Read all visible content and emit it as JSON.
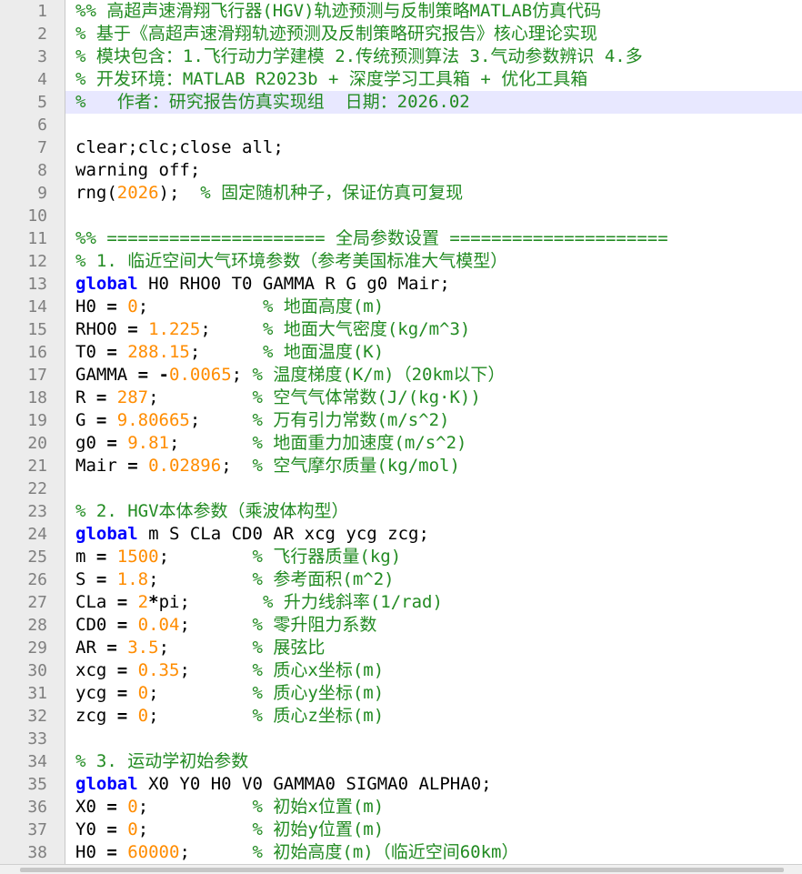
{
  "editor": {
    "current_line": 5,
    "colors": {
      "comment": "#228b22",
      "keyword": "#0000ff",
      "number": "#ff8c00",
      "code": "#000000",
      "current_line_bg": "#e8e8ff"
    },
    "lines": [
      {
        "n": "1",
        "tokens": [
          {
            "t": "%% 高超声速滑翔飞行器(HGV)轨迹预测与反制策略MATLAB仿真代码",
            "c": "comment"
          }
        ]
      },
      {
        "n": "2",
        "tokens": [
          {
            "t": "% 基于《高超声速滑翔轨迹预测及反制策略研究报告》核心理论实现",
            "c": "comment"
          }
        ]
      },
      {
        "n": "3",
        "tokens": [
          {
            "t": "% 模块包含：1.飞行动力学建模 2.传统预测算法 3.气动参数辨识 4.多",
            "c": "comment"
          }
        ]
      },
      {
        "n": "4",
        "tokens": [
          {
            "t": "% 开发环境：MATLAB R2023b + 深度学习工具箱 + 优化工具箱",
            "c": "comment"
          }
        ]
      },
      {
        "n": "5",
        "tokens": [
          {
            "t": "%   作者：研究报告仿真实现组  日期：2026.02",
            "c": "comment"
          }
        ]
      },
      {
        "n": "6",
        "tokens": []
      },
      {
        "n": "7",
        "tokens": [
          {
            "t": "clear;clc;close all;",
            "c": "code"
          }
        ]
      },
      {
        "n": "8",
        "tokens": [
          {
            "t": "warning off;",
            "c": "code"
          }
        ]
      },
      {
        "n": "9",
        "tokens": [
          {
            "t": "rng(",
            "c": "code"
          },
          {
            "t": "2026",
            "c": "number"
          },
          {
            "t": ");  ",
            "c": "code"
          },
          {
            "t": "% 固定随机种子，保证仿真可复现",
            "c": "comment"
          }
        ]
      },
      {
        "n": "10",
        "tokens": []
      },
      {
        "n": "11",
        "tokens": [
          {
            "t": "%% ===================== 全局参数设置 =====================",
            "c": "comment"
          }
        ]
      },
      {
        "n": "12",
        "tokens": [
          {
            "t": "% 1. 临近空间大气环境参数（参考美国标准大气模型）",
            "c": "comment"
          }
        ]
      },
      {
        "n": "13",
        "tokens": [
          {
            "t": "global",
            "c": "keyword"
          },
          {
            "t": " H0 RHO0 T0 GAMMA R G g0 Mair;",
            "c": "code"
          }
        ]
      },
      {
        "n": "14",
        "tokens": [
          {
            "t": "H0 ",
            "c": "code"
          },
          {
            "t": "=",
            "c": "op"
          },
          {
            "t": " ",
            "c": "code"
          },
          {
            "t": "0",
            "c": "number"
          },
          {
            "t": ";           ",
            "c": "code"
          },
          {
            "t": "% 地面高度(m)",
            "c": "comment"
          }
        ]
      },
      {
        "n": "15",
        "tokens": [
          {
            "t": "RHO0 ",
            "c": "code"
          },
          {
            "t": "=",
            "c": "op"
          },
          {
            "t": " ",
            "c": "code"
          },
          {
            "t": "1.225",
            "c": "number"
          },
          {
            "t": ";     ",
            "c": "code"
          },
          {
            "t": "% 地面大气密度(kg/m^3)",
            "c": "comment"
          }
        ]
      },
      {
        "n": "16",
        "tokens": [
          {
            "t": "T0 ",
            "c": "code"
          },
          {
            "t": "=",
            "c": "op"
          },
          {
            "t": " ",
            "c": "code"
          },
          {
            "t": "288.15",
            "c": "number"
          },
          {
            "t": ";      ",
            "c": "code"
          },
          {
            "t": "% 地面温度(K)",
            "c": "comment"
          }
        ]
      },
      {
        "n": "17",
        "tokens": [
          {
            "t": "GAMMA ",
            "c": "code"
          },
          {
            "t": "=",
            "c": "op"
          },
          {
            "t": " ",
            "c": "code"
          },
          {
            "t": "-",
            "c": "op"
          },
          {
            "t": "0.0065",
            "c": "number"
          },
          {
            "t": "; ",
            "c": "code"
          },
          {
            "t": "% 温度梯度(K/m)（20km以下）",
            "c": "comment"
          }
        ]
      },
      {
        "n": "18",
        "tokens": [
          {
            "t": "R ",
            "c": "code"
          },
          {
            "t": "=",
            "c": "op"
          },
          {
            "t": " ",
            "c": "code"
          },
          {
            "t": "287",
            "c": "number"
          },
          {
            "t": ";         ",
            "c": "code"
          },
          {
            "t": "% 空气气体常数(J/(kg·K))",
            "c": "comment"
          }
        ]
      },
      {
        "n": "19",
        "tokens": [
          {
            "t": "G ",
            "c": "code"
          },
          {
            "t": "=",
            "c": "op"
          },
          {
            "t": " ",
            "c": "code"
          },
          {
            "t": "9.80665",
            "c": "number"
          },
          {
            "t": ";     ",
            "c": "code"
          },
          {
            "t": "% 万有引力常数(m/s^2)",
            "c": "comment"
          }
        ]
      },
      {
        "n": "20",
        "tokens": [
          {
            "t": "g0 ",
            "c": "code"
          },
          {
            "t": "=",
            "c": "op"
          },
          {
            "t": " ",
            "c": "code"
          },
          {
            "t": "9.81",
            "c": "number"
          },
          {
            "t": ";       ",
            "c": "code"
          },
          {
            "t": "% 地面重力加速度(m/s^2)",
            "c": "comment"
          }
        ]
      },
      {
        "n": "21",
        "tokens": [
          {
            "t": "Mair ",
            "c": "code"
          },
          {
            "t": "=",
            "c": "op"
          },
          {
            "t": " ",
            "c": "code"
          },
          {
            "t": "0.02896",
            "c": "number"
          },
          {
            "t": ";  ",
            "c": "code"
          },
          {
            "t": "% 空气摩尔质量(kg/mol)",
            "c": "comment"
          }
        ]
      },
      {
        "n": "22",
        "tokens": []
      },
      {
        "n": "23",
        "tokens": [
          {
            "t": "% 2. HGV本体参数（乘波体构型）",
            "c": "comment"
          }
        ]
      },
      {
        "n": "24",
        "tokens": [
          {
            "t": "global",
            "c": "keyword"
          },
          {
            "t": " m S CLa CD0 AR xcg ycg zcg;",
            "c": "code"
          }
        ]
      },
      {
        "n": "25",
        "tokens": [
          {
            "t": "m ",
            "c": "code"
          },
          {
            "t": "=",
            "c": "op"
          },
          {
            "t": " ",
            "c": "code"
          },
          {
            "t": "1500",
            "c": "number"
          },
          {
            "t": ";        ",
            "c": "code"
          },
          {
            "t": "% 飞行器质量(kg)",
            "c": "comment"
          }
        ]
      },
      {
        "n": "26",
        "tokens": [
          {
            "t": "S ",
            "c": "code"
          },
          {
            "t": "=",
            "c": "op"
          },
          {
            "t": " ",
            "c": "code"
          },
          {
            "t": "1.8",
            "c": "number"
          },
          {
            "t": ";         ",
            "c": "code"
          },
          {
            "t": "% 参考面积(m^2)",
            "c": "comment"
          }
        ]
      },
      {
        "n": "27",
        "tokens": [
          {
            "t": "CLa ",
            "c": "code"
          },
          {
            "t": "=",
            "c": "op"
          },
          {
            "t": " ",
            "c": "code"
          },
          {
            "t": "2",
            "c": "number"
          },
          {
            "t": "*",
            "c": "op"
          },
          {
            "t": "pi;       ",
            "c": "code"
          },
          {
            "t": "% 升力线斜率(1/rad)",
            "c": "comment"
          }
        ]
      },
      {
        "n": "28",
        "tokens": [
          {
            "t": "CD0 ",
            "c": "code"
          },
          {
            "t": "=",
            "c": "op"
          },
          {
            "t": " ",
            "c": "code"
          },
          {
            "t": "0.04",
            "c": "number"
          },
          {
            "t": ";      ",
            "c": "code"
          },
          {
            "t": "% 零升阻力系数",
            "c": "comment"
          }
        ]
      },
      {
        "n": "29",
        "tokens": [
          {
            "t": "AR ",
            "c": "code"
          },
          {
            "t": "=",
            "c": "op"
          },
          {
            "t": " ",
            "c": "code"
          },
          {
            "t": "3.5",
            "c": "number"
          },
          {
            "t": ";        ",
            "c": "code"
          },
          {
            "t": "% 展弦比",
            "c": "comment"
          }
        ]
      },
      {
        "n": "30",
        "tokens": [
          {
            "t": "xcg ",
            "c": "code"
          },
          {
            "t": "=",
            "c": "op"
          },
          {
            "t": " ",
            "c": "code"
          },
          {
            "t": "0.35",
            "c": "number"
          },
          {
            "t": ";      ",
            "c": "code"
          },
          {
            "t": "% 质心x坐标(m)",
            "c": "comment"
          }
        ]
      },
      {
        "n": "31",
        "tokens": [
          {
            "t": "ycg ",
            "c": "code"
          },
          {
            "t": "=",
            "c": "op"
          },
          {
            "t": " ",
            "c": "code"
          },
          {
            "t": "0",
            "c": "number"
          },
          {
            "t": ";         ",
            "c": "code"
          },
          {
            "t": "% 质心y坐标(m)",
            "c": "comment"
          }
        ]
      },
      {
        "n": "32",
        "tokens": [
          {
            "t": "zcg ",
            "c": "code"
          },
          {
            "t": "=",
            "c": "op"
          },
          {
            "t": " ",
            "c": "code"
          },
          {
            "t": "0",
            "c": "number"
          },
          {
            "t": ";         ",
            "c": "code"
          },
          {
            "t": "% 质心z坐标(m)",
            "c": "comment"
          }
        ]
      },
      {
        "n": "33",
        "tokens": []
      },
      {
        "n": "34",
        "tokens": [
          {
            "t": "% 3. 运动学初始参数",
            "c": "comment"
          }
        ]
      },
      {
        "n": "35",
        "tokens": [
          {
            "t": "global",
            "c": "keyword"
          },
          {
            "t": " X0 Y0 H0 V0 GAMMA0 SIGMA0 ALPHA0;",
            "c": "code"
          }
        ]
      },
      {
        "n": "36",
        "tokens": [
          {
            "t": "X0 ",
            "c": "code"
          },
          {
            "t": "=",
            "c": "op"
          },
          {
            "t": " ",
            "c": "code"
          },
          {
            "t": "0",
            "c": "number"
          },
          {
            "t": ";          ",
            "c": "code"
          },
          {
            "t": "% 初始x位置(m)",
            "c": "comment"
          }
        ]
      },
      {
        "n": "37",
        "tokens": [
          {
            "t": "Y0 ",
            "c": "code"
          },
          {
            "t": "=",
            "c": "op"
          },
          {
            "t": " ",
            "c": "code"
          },
          {
            "t": "0",
            "c": "number"
          },
          {
            "t": ";          ",
            "c": "code"
          },
          {
            "t": "% 初始y位置(m)",
            "c": "comment"
          }
        ]
      },
      {
        "n": "38",
        "tokens": [
          {
            "t": "H0 ",
            "c": "code"
          },
          {
            "t": "=",
            "c": "op"
          },
          {
            "t": " ",
            "c": "code"
          },
          {
            "t": "60000",
            "c": "number"
          },
          {
            "t": ";      ",
            "c": "code"
          },
          {
            "t": "% 初始高度(m)（临近空间60km）",
            "c": "comment"
          }
        ]
      }
    ]
  }
}
